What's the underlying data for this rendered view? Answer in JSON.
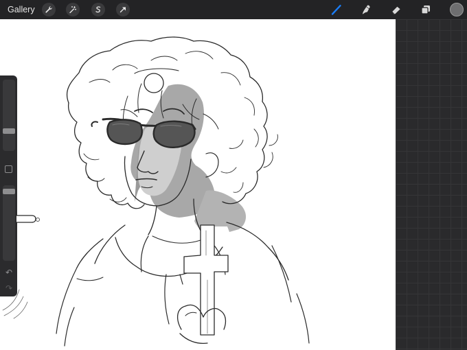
{
  "topbar": {
    "gallery_label": "Gallery",
    "left_buttons": [
      {
        "name": "actions-wrench-icon"
      },
      {
        "name": "adjustments-magic-wand-icon"
      },
      {
        "name": "selection-s-icon"
      },
      {
        "name": "transform-arrow-icon"
      }
    ],
    "tools": [
      {
        "name": "brush-icon",
        "active": true
      },
      {
        "name": "smudge-icon",
        "active": false
      },
      {
        "name": "eraser-icon",
        "active": false
      },
      {
        "name": "layers-icon",
        "active": false
      }
    ],
    "current_color": "#6e6e70",
    "accent_color": "#1a7cf5"
  },
  "sidebar": {
    "brush_size_level": 0.74,
    "opacity_level": 0.05,
    "modify_icon": "square-icon",
    "undo_icon": "undo-icon",
    "redo_icon": "redo-icon"
  },
  "canvas": {
    "background": "#ffffff"
  }
}
